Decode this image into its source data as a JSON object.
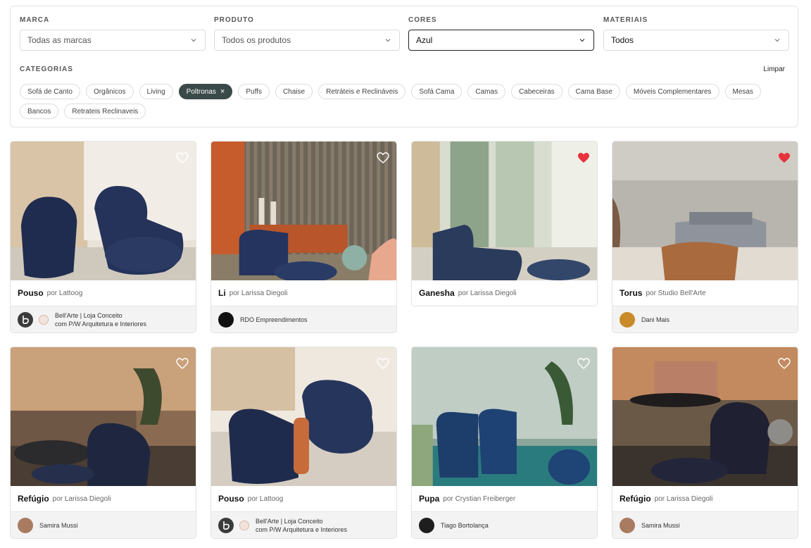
{
  "filters": {
    "marca": {
      "label": "MARCA",
      "value": "Todas as marcas"
    },
    "produto": {
      "label": "PRODUTO",
      "value": "Todos os produtos"
    },
    "cores": {
      "label": "CORES",
      "value": "Azul"
    },
    "materiais": {
      "label": "MATERIAIS",
      "value": "Todos"
    }
  },
  "categories": {
    "label": "CATEGORIAS",
    "clear": "Limpar",
    "chips": [
      {
        "label": "Sofá de Canto"
      },
      {
        "label": "Orgânicos"
      },
      {
        "label": "Living"
      },
      {
        "label": "Poltronas",
        "selected": true
      },
      {
        "label": "Puffs"
      },
      {
        "label": "Chaise"
      },
      {
        "label": "Retráteis e Reclináveis"
      },
      {
        "label": "Sofá Cama"
      },
      {
        "label": "Camas"
      },
      {
        "label": "Cabeceiras"
      },
      {
        "label": "Cama Base"
      },
      {
        "label": "Móveis Complementares"
      },
      {
        "label": "Mesas"
      },
      {
        "label": "Bancos"
      },
      {
        "label": "Retrateis Reclinaveis"
      }
    ],
    "remove_icon": "×"
  },
  "products": [
    {
      "name": "Pouso",
      "by": "por Lattoog",
      "liked": false,
      "footer_line1": "Bell'Arte | Loja Conceito",
      "footer_line2": "com P/W Arquitetura e Interiores",
      "footer_type": "store"
    },
    {
      "name": "Li",
      "by": "por Larissa Diegoli",
      "liked": false,
      "footer_line1": "RDO Empreendimentos",
      "footer_line2": "",
      "footer_type": "single"
    },
    {
      "name": "Ganesha",
      "by": "por Larissa Diegoli",
      "liked": true,
      "footer_line1": "",
      "footer_line2": "",
      "footer_type": "none"
    },
    {
      "name": "Torus",
      "by": "por Studio Bell'Arte",
      "liked": true,
      "footer_line1": "Dani Mais",
      "footer_line2": "",
      "footer_type": "single"
    },
    {
      "name": "Refúgio",
      "by": "por Larissa Diegoli",
      "liked": false,
      "footer_line1": "Samira Mussi",
      "footer_line2": "",
      "footer_type": "single"
    },
    {
      "name": "Pouso",
      "by": "por Lattoog",
      "liked": false,
      "footer_line1": "Bell'Arte | Loja Conceito",
      "footer_line2": "com P/W Arquitetura e Interiores",
      "footer_type": "store"
    },
    {
      "name": "Pupa",
      "by": "por Crystian Freiberger",
      "liked": false,
      "footer_line1": "Tiago Bortolança",
      "footer_line2": "",
      "footer_type": "single"
    },
    {
      "name": "Refúgio",
      "by": "por Larissa Diegoli",
      "liked": false,
      "footer_line1": "Samira Mussi",
      "footer_line2": "",
      "footer_type": "single"
    }
  ],
  "colors": {
    "liked": "#e8323c",
    "chip_selected": "#3a4a48"
  }
}
